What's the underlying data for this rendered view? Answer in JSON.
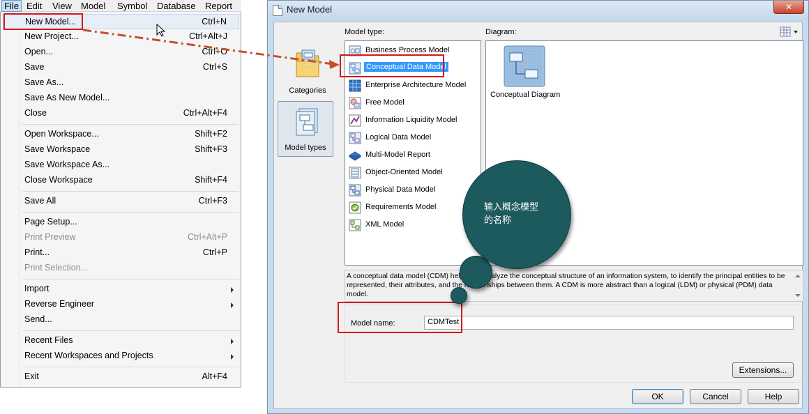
{
  "menubar": {
    "items": [
      "File",
      "Edit",
      "View",
      "Model",
      "Symbol",
      "Database",
      "Report"
    ]
  },
  "file_menu": {
    "items": [
      {
        "label": "New Model...",
        "shortcut": "Ctrl+N"
      },
      {
        "label": "New Project...",
        "shortcut": "Ctrl+Alt+J"
      },
      {
        "label": "Open...",
        "shortcut": "Ctrl+O"
      },
      {
        "label": "Save",
        "shortcut": "Ctrl+S"
      },
      {
        "label": "Save As...",
        "shortcut": ""
      },
      {
        "label": "Save As New Model...",
        "shortcut": ""
      },
      {
        "label": "Close",
        "shortcut": "Ctrl+Alt+F4"
      },
      {
        "label": "Open Workspace...",
        "shortcut": "Shift+F2"
      },
      {
        "label": "Save Workspace",
        "shortcut": "Shift+F3"
      },
      {
        "label": "Save Workspace As...",
        "shortcut": ""
      },
      {
        "label": "Close Workspace",
        "shortcut": "Shift+F4"
      },
      {
        "label": "Save All",
        "shortcut": "Ctrl+F3"
      },
      {
        "label": "Page Setup...",
        "shortcut": ""
      },
      {
        "label": "Print Preview",
        "shortcut": "Ctrl+Alt+P"
      },
      {
        "label": "Print...",
        "shortcut": "Ctrl+P"
      },
      {
        "label": "Print Selection...",
        "shortcut": ""
      },
      {
        "label": "Import",
        "shortcut": ""
      },
      {
        "label": "Reverse Engineer",
        "shortcut": ""
      },
      {
        "label": "Send...",
        "shortcut": ""
      },
      {
        "label": "Recent Files",
        "shortcut": ""
      },
      {
        "label": "Recent Workspaces and Projects",
        "shortcut": ""
      },
      {
        "label": "Exit",
        "shortcut": "Alt+F4"
      }
    ]
  },
  "dialog": {
    "title": "New Model",
    "close_label": "✕",
    "side_tools": [
      {
        "label": "Categories"
      },
      {
        "label": "Model types"
      }
    ],
    "model_type_label": "Model type:",
    "diagram_label": "Diagram:",
    "model_types": [
      {
        "label": "Business Process Model",
        "icon": "business-process-icon"
      },
      {
        "label": "Conceptual Data Model",
        "icon": "conceptual-data-icon"
      },
      {
        "label": "Enterprise Architecture Model",
        "icon": "enterprise-architecture-icon"
      },
      {
        "label": "Free Model",
        "icon": "free-model-icon"
      },
      {
        "label": "Information Liquidity Model",
        "icon": "information-liquidity-icon"
      },
      {
        "label": "Logical Data Model",
        "icon": "logical-data-icon"
      },
      {
        "label": "Multi-Model Report",
        "icon": "multi-model-report-icon"
      },
      {
        "label": "Object-Oriented Model",
        "icon": "object-oriented-icon"
      },
      {
        "label": "Physical Data Model",
        "icon": "physical-data-icon"
      },
      {
        "label": "Requirements Model",
        "icon": "requirements-icon"
      },
      {
        "label": "XML Model",
        "icon": "xml-model-icon"
      }
    ],
    "selected_model_type": "Conceptual Data Model",
    "diagrams": [
      {
        "label": "Conceptual Diagram",
        "icon": "conceptual-diagram-icon"
      }
    ],
    "description": "A conceptual data model (CDM) helps you analyze the conceptual structure of an information system, to identify the principal entities to be represented, their attributes, and the relationships between them. A CDM is more abstract than a logical (LDM) or physical (PDM) data model.",
    "model_name_label": "Model name:",
    "model_name_value": "CDMTest",
    "buttons": {
      "extensions": "Extensions...",
      "ok": "OK",
      "cancel": "Cancel",
      "help": "Help"
    }
  },
  "callout": {
    "text_line1": "输入概念模型",
    "text_line2": "的名称",
    "color": "#1d5a5e"
  },
  "colors": {
    "highlight_red": "#d11a1a",
    "selection_blue": "#3399ff"
  }
}
